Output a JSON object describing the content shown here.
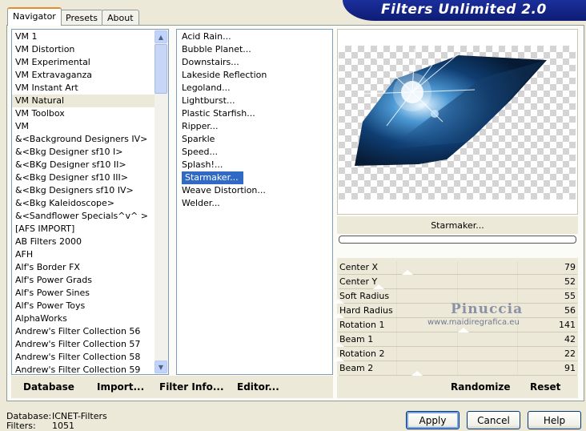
{
  "header": {
    "title": "Filters Unlimited 2.0"
  },
  "tabs": [
    {
      "label": "Navigator",
      "active": true
    },
    {
      "label": "Presets",
      "active": false
    },
    {
      "label": "About",
      "active": false
    }
  ],
  "categories": [
    "VM 1",
    "VM Distortion",
    "VM Experimental",
    "VM Extravaganza",
    "VM Instant Art",
    "VM Natural",
    "VM Toolbox",
    "VM",
    "&<Background Designers IV>",
    "&<Bkg Designer sf10 I>",
    "&<BKg Designer sf10 II>",
    "&<Bkg Designer sf10 III>",
    "&<Bkg Designers sf10 IV>",
    "&<Bkg Kaleidoscope>",
    "&<Sandflower Specials^v^ >",
    "[AFS IMPORT]",
    "AB Filters 2000",
    "AFH",
    "Alf's Border FX",
    "Alf's Power Grads",
    "Alf's Power Sines",
    "Alf's Power Toys",
    "AlphaWorks",
    "Andrew's Filter Collection 56",
    "Andrew's Filter Collection 57",
    "Andrew's Filter Collection 58",
    "Andrew's Filter Collection 59"
  ],
  "selected_category": "VM Natural",
  "filters": [
    "Acid Rain...",
    "Bubble Planet...",
    "Downstairs...",
    "Lakeside Reflection",
    "Legoland...",
    "Lightburst...",
    "Plastic Starfish...",
    "Ripper...",
    "Sparkle",
    "Speed...",
    "Splash!...",
    "Starmaker...",
    "Weave Distortion...",
    "Welder..."
  ],
  "selected_filter": "Starmaker...",
  "preview": {
    "filter_name": "Starmaker...",
    "watermark_name": "Pinuccia",
    "watermark_url": "www.maidiregrafica.eu"
  },
  "params": [
    {
      "label": "Center X",
      "value": "79"
    },
    {
      "label": "Center Y",
      "value": "52"
    },
    {
      "label": "Soft Radius",
      "value": "55"
    },
    {
      "label": "Hard Radius",
      "value": "56"
    },
    {
      "label": "Rotation 1",
      "value": "141"
    },
    {
      "label": "Beam 1",
      "value": "42"
    },
    {
      "label": "Rotation 2",
      "value": "22"
    },
    {
      "label": "Beam 2",
      "value": "91"
    }
  ],
  "toolbar": {
    "database": "Database",
    "import": "Import...",
    "filter_info": "Filter Info...",
    "editor": "Editor...",
    "randomize": "Randomize",
    "reset": "Reset"
  },
  "status": {
    "database_label": "Database:",
    "database_value": "ICNET-Filters",
    "filters_label": "Filters:",
    "filters_value": "1051"
  },
  "buttons": {
    "apply": "Apply",
    "cancel": "Cancel",
    "help": "Help"
  },
  "colors": {
    "banner": "#0e1c74",
    "selection": "#316ac5",
    "face": "#ece9d8"
  }
}
